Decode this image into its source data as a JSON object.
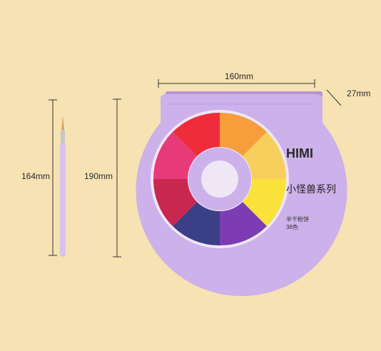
{
  "dimensions": {
    "width_label": "160mm",
    "depth_label": "27mm",
    "brush_length_label": "164mm",
    "case_height_label": "190mm"
  },
  "product": {
    "brand": "HIMI",
    "series_name": "小怪兽系列",
    "subtitle": "半干粉饼",
    "color_count": "38色"
  },
  "colors": {
    "background": "#f7e2b3",
    "case": "#cdb1ea",
    "case_shadow": "#b596d8",
    "brush_tip": "#d6a25f"
  }
}
